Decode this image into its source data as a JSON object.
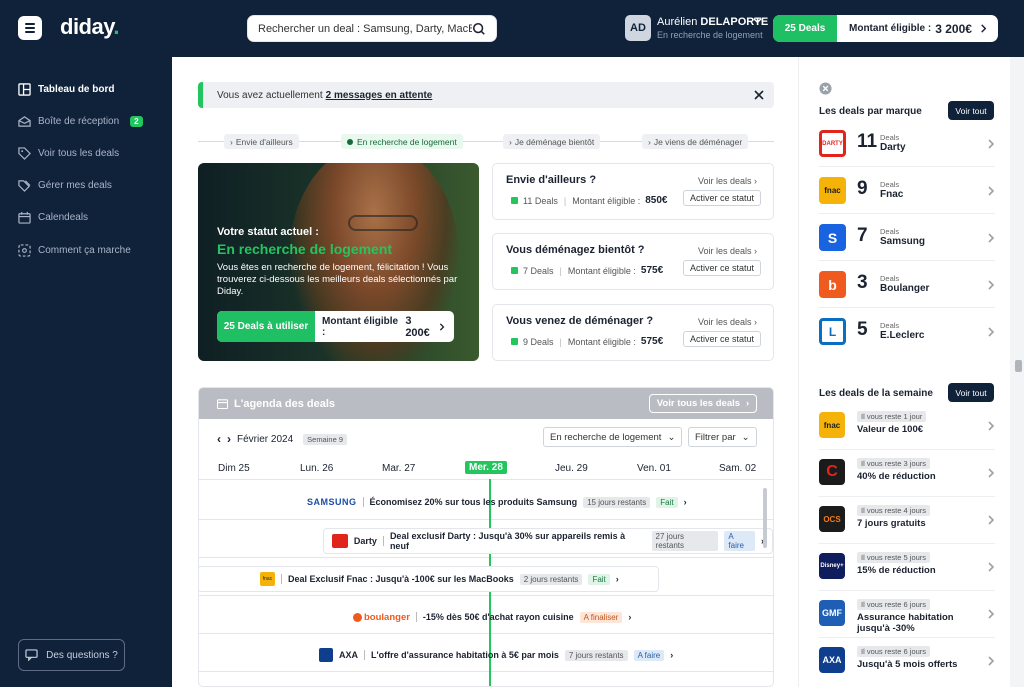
{
  "app": {
    "logo_text": "diday",
    "logo_dot": "."
  },
  "search": {
    "placeholder": "Rechercher un deal : Samsung, Darty, MacBook..."
  },
  "user": {
    "initials": "AD",
    "first_name": "Aurélien",
    "last_name": "DELAPORTE",
    "status": "En recherche de logement"
  },
  "top_pill": {
    "deals": "25 Deals",
    "amount_label": "Montant éligible :",
    "amount_value": "3 200€"
  },
  "sidebar": {
    "items": [
      {
        "label": "Tableau de bord",
        "icon": "dashboard-icon"
      },
      {
        "label": "Boîte de réception",
        "icon": "inbox-icon",
        "badge": "2"
      },
      {
        "label": "Voir tous les deals",
        "icon": "tag-icon"
      },
      {
        "label": "Gérer mes deals",
        "icon": "tags-icon"
      },
      {
        "label": "Calendeals",
        "icon": "calendar-icon"
      },
      {
        "label": "Comment ça marche",
        "icon": "help-icon"
      }
    ],
    "questions": "Des questions ?"
  },
  "alert": {
    "text": "Vous avez actuellement",
    "link": "2 messages en attente"
  },
  "steps": [
    {
      "label": "Envie d'ailleurs"
    },
    {
      "label": "En recherche de logement"
    },
    {
      "label": "Je déménage bientôt"
    },
    {
      "label": "Je viens de déménager"
    }
  ],
  "hero": {
    "status_label": "Votre statut actuel :",
    "status_value": "En recherche de logement",
    "description": "Vous êtes en recherche de logement, félicitation ! Vous trouverez ci-dessous les meilleurs deals sélectionnés par Diday.",
    "deals": "25 Deals à utiliser",
    "amount_label": "Montant éligible :",
    "amount_value": "3 200€"
  },
  "status_cards": [
    {
      "title": "Envie d'ailleurs ?",
      "see": "Voir les deals",
      "deals": "11 Deals",
      "amount_label": "Montant éligible :",
      "amount": "850€",
      "action": "Activer ce statut"
    },
    {
      "title": "Vous déménagez bientôt ?",
      "see": "Voir les deals",
      "deals": "7 Deals",
      "amount_label": "Montant éligible :",
      "amount": "575€",
      "action": "Activer ce statut"
    },
    {
      "title": "Vous venez de déménager ?",
      "see": "Voir les deals",
      "deals": "9 Deals",
      "amount_label": "Montant éligible :",
      "amount": "575€",
      "action": "Activer ce statut"
    }
  ],
  "agenda": {
    "title": "L'agenda des deals",
    "see_all": "Voir tous les deals",
    "month": "Février 2024",
    "week": "Semaine 9",
    "filter_status": "En recherche de logement",
    "filter_by": "Filtrer par",
    "days": [
      "Dim 25",
      "Lun. 26",
      "Mar. 27",
      "Mer. 28",
      "Jeu. 29",
      "Ven. 01",
      "Sam. 02"
    ],
    "deals": [
      {
        "brand": "SAMSUNG",
        "text": "Économisez 20% sur tous les produits Samsung",
        "remaining": "15 jours restants",
        "state": "Fait",
        "state_kind": "green"
      },
      {
        "brand": "Darty",
        "text": "Deal exclusif Darty : Jusqu'à 30% sur appareils remis à neuf",
        "remaining": "27 jours restants",
        "state": "A faire",
        "state_kind": "blue"
      },
      {
        "brand": "fnac",
        "text": "Deal Exclusif Fnac : Jusqu'à -100€ sur les MacBooks",
        "remaining": "2 jours restants",
        "state": "Fait",
        "state_kind": "green"
      },
      {
        "brand": "boulanger",
        "text": "-15% dès 50€ d'achat rayon cuisine",
        "remaining": "",
        "state": "A finaliser",
        "state_kind": "orange"
      },
      {
        "brand": "AXA",
        "text": "L'offre d'assurance habitation à 5€ par mois",
        "remaining": "7 jours restants",
        "state": "A faire",
        "state_kind": "blue"
      }
    ]
  },
  "right": {
    "brands_title": "Les deals par marque",
    "see_all": "Voir tout",
    "brands": [
      {
        "count": "11",
        "deals_label": "Deals",
        "name": "Darty",
        "logo": "DARTY",
        "color": "#e1251b"
      },
      {
        "count": "9",
        "deals_label": "Deals",
        "name": "Fnac",
        "logo": "fnac",
        "color": "#f5b30a"
      },
      {
        "count": "7",
        "deals_label": "Deals",
        "name": "Samsung",
        "logo": "S",
        "color": "#1a63e0"
      },
      {
        "count": "3",
        "deals_label": "Deals",
        "name": "Boulanger",
        "logo": "b",
        "color": "#ef5a1e"
      },
      {
        "count": "5",
        "deals_label": "Deals",
        "name": "E.Leclerc",
        "logo": "L",
        "color": "#0a6fc2"
      }
    ],
    "week_title": "Les deals de la semaine",
    "week_deals": [
      {
        "tag": "Il vous reste 1 jour",
        "title": "Valeur de 100€",
        "logo": "fnac",
        "color": "#f5b30a"
      },
      {
        "tag": "Il vous reste 3 jours",
        "title": "40% de réduction",
        "logo": "C",
        "color": "#1b1b1b"
      },
      {
        "tag": "Il vous reste 4 jours",
        "title": "7 jours gratuits",
        "logo": "OCS",
        "color": "#1b1b1b"
      },
      {
        "tag": "Il vous reste 5 jours",
        "title": "15% de réduction",
        "logo": "Disney+",
        "color": "#0f1d5c"
      },
      {
        "tag": "Il vous reste 6 jours",
        "title": "Assurance habitation jusqu'à -30%",
        "logo": "GMF",
        "color": "#1e5fb5"
      },
      {
        "tag": "Il vous reste 6 jours",
        "title": "Jusqu'à 5 mois offerts",
        "logo": "AXA",
        "color": "#103e8f"
      }
    ]
  }
}
